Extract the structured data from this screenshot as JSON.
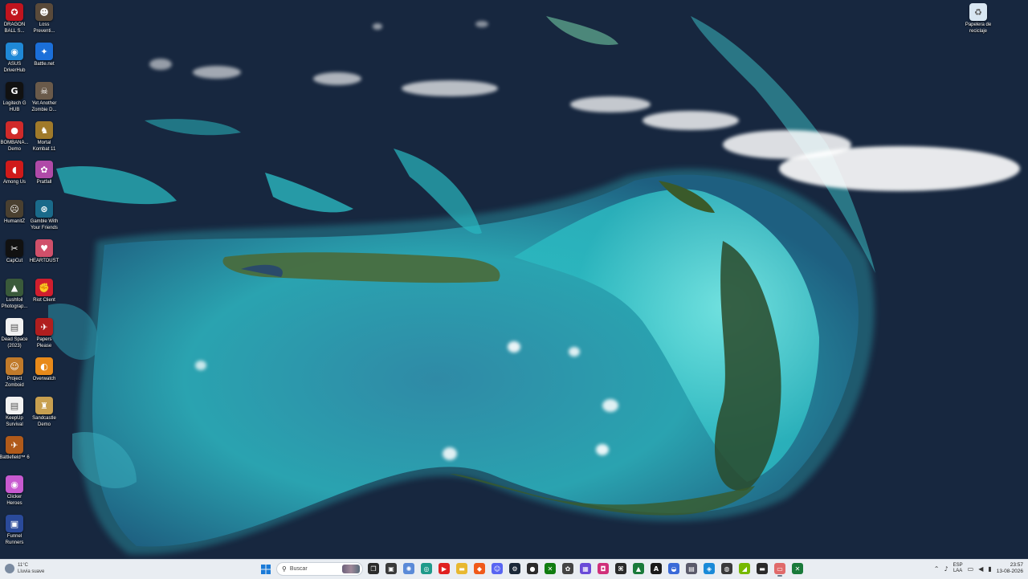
{
  "desktop": {
    "icons": [
      {
        "id": "dragon-ball",
        "label": "DRAGON\nBALL S...",
        "glyph": "✪",
        "color": "#c0141e"
      },
      {
        "id": "loss-prevention",
        "label": "Loss\nPreventi...",
        "glyph": "☻",
        "color": "#5a4a3a"
      },
      {
        "id": "asus-driverhub",
        "label": "ASUS\nDriverHub",
        "glyph": "◉",
        "color": "#1f88d6"
      },
      {
        "id": "battlenet",
        "label": "Battle.net",
        "glyph": "✦",
        "color": "#1b6fd9"
      },
      {
        "id": "logitech-ghub",
        "label": "Logitech G\nHUB",
        "glyph": "G",
        "color": "#111111"
      },
      {
        "id": "yet-another-zombie",
        "label": "Yet Another\nZombie D...",
        "glyph": "☠",
        "color": "#6a5a4a"
      },
      {
        "id": "bombanauts",
        "label": "BOMBANA...\nDemo",
        "glyph": "●",
        "color": "#d02a2a"
      },
      {
        "id": "mortal-kombat",
        "label": "Mortal\nKombat 11",
        "glyph": "♞",
        "color": "#a07a2a"
      },
      {
        "id": "among-us",
        "label": "Among Us",
        "glyph": "◖",
        "color": "#d01a1a"
      },
      {
        "id": "pratfall",
        "label": "Pratfall",
        "glyph": "✿",
        "color": "#b04aa8"
      },
      {
        "id": "humanitz",
        "label": "HumanitZ",
        "glyph": "☹",
        "color": "#4a4030"
      },
      {
        "id": "gamble-friends",
        "label": "Gamble With\nYour Friends",
        "glyph": "⊛",
        "color": "#1a6a8a"
      },
      {
        "id": "capcut",
        "label": "CapCut",
        "glyph": "✂",
        "color": "#111111"
      },
      {
        "id": "heartdust",
        "label": "HEARTDUST",
        "glyph": "♥",
        "color": "#d0506a"
      },
      {
        "id": "lushfoil",
        "label": "Lushfoil\nPhotograp...",
        "glyph": "▲",
        "color": "#3a5a3a"
      },
      {
        "id": "riot-client",
        "label": "Riot Client",
        "glyph": "✊",
        "color": "#d01e2e"
      },
      {
        "id": "dead-space",
        "label": "Dead Space\n(2023)",
        "glyph": "▤",
        "color": "#f2f2f2"
      },
      {
        "id": "papers-please",
        "label": "Papers\nPlease",
        "glyph": "✈",
        "color": "#b01e1e"
      },
      {
        "id": "project-zomboid",
        "label": "Project\nZomboid",
        "glyph": "☺",
        "color": "#c07a2a"
      },
      {
        "id": "overwatch",
        "label": "Overwatch",
        "glyph": "◐",
        "color": "#e88a1a"
      },
      {
        "id": "keepup-survival",
        "label": "KeepUp\nSurvival",
        "glyph": "▤",
        "color": "#f2f2f2"
      },
      {
        "id": "sandcastle-demo",
        "label": "Sandcastle\nDemo",
        "glyph": "♜",
        "color": "#c8a050"
      },
      {
        "id": "battlefield-6",
        "label": "Battlefield™ 6",
        "glyph": "✈",
        "color": "#b05a1a"
      },
      {
        "id": "clicker-heroes",
        "label": "Clicker\nHeroes",
        "glyph": "◉",
        "color": "#c85ad0"
      },
      {
        "id": "funnel-runners",
        "label": "Funnel\nRunners",
        "glyph": "▣",
        "color": "#2a4a9a"
      },
      {
        "id": "recycle-bin",
        "label": "Papelera de\nreciclaje",
        "glyph": "♻",
        "color": "#d8e6f2"
      }
    ]
  },
  "taskbar": {
    "weather_temp": "11°C",
    "weather_desc": "Lluvia suave",
    "search_placeholder": "Buscar",
    "apps": [
      {
        "id": "task-view",
        "glyph": "❐",
        "color": "#2b2b2b"
      },
      {
        "id": "media",
        "glyph": "▣",
        "color": "#3a3a3a"
      },
      {
        "id": "copilot",
        "glyph": "✺",
        "color": "#5a8ad8"
      },
      {
        "id": "edge",
        "glyph": "◎",
        "color": "#1f9a8a"
      },
      {
        "id": "youtube-music",
        "glyph": "▶",
        "color": "#e02020"
      },
      {
        "id": "file-explorer",
        "glyph": "▬",
        "color": "#e8b830"
      },
      {
        "id": "brave",
        "glyph": "◆",
        "color": "#f05a1a"
      },
      {
        "id": "discord",
        "glyph": "☺",
        "color": "#5865f2"
      },
      {
        "id": "steam",
        "glyph": "⚙",
        "color": "#1b2838"
      },
      {
        "id": "obs",
        "glyph": "●",
        "color": "#2b2b2b"
      },
      {
        "id": "xbox",
        "glyph": "✕",
        "color": "#107c10"
      },
      {
        "id": "chatgpt",
        "glyph": "✿",
        "color": "#444444"
      },
      {
        "id": "app-grid",
        "glyph": "▦",
        "color": "#6a4ad8"
      },
      {
        "id": "instagram",
        "glyph": "◘",
        "color": "#d0307a"
      },
      {
        "id": "terminal",
        "glyph": "⌘",
        "color": "#2a2a2a"
      },
      {
        "id": "code-app",
        "glyph": "▲",
        "color": "#1a7a3a"
      },
      {
        "id": "anthropic",
        "glyph": "A",
        "color": "#1a1a1a"
      },
      {
        "id": "vpn",
        "glyph": "◒",
        "color": "#3a6ad8"
      },
      {
        "id": "calculator",
        "glyph": "▤",
        "color": "#5a5a6a"
      },
      {
        "id": "cursor",
        "glyph": "◈",
        "color": "#1a8ad8"
      },
      {
        "id": "capture",
        "glyph": "◍",
        "color": "#3a3a3a"
      },
      {
        "id": "nvidia",
        "glyph": "◢",
        "color": "#76b900"
      },
      {
        "id": "camera",
        "glyph": "▬",
        "color": "#2a2a2a"
      },
      {
        "id": "active-window",
        "glyph": "▭",
        "color": "#e06a6a"
      },
      {
        "id": "excel",
        "glyph": "✕",
        "color": "#1a7a3a"
      }
    ],
    "tray": {
      "lang_line1": "ESP",
      "lang_line2": "LAA",
      "time": "23:57",
      "date": "13-08-2026"
    }
  }
}
